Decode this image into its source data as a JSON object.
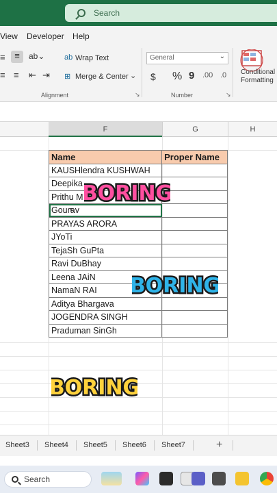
{
  "search": {
    "placeholder": "Search"
  },
  "menu": [
    "View",
    "Developer",
    "Help"
  ],
  "ribbon": {
    "wrap_text": "Wrap Text",
    "merge_center": "Merge & Center",
    "number_format": "General",
    "currency_symbol": "$",
    "percent_symbol": "%",
    "comma_symbol": "9",
    "conditional_line1": "Conditional",
    "conditional_line2": "Formatting",
    "alignment_label": "Alignment",
    "number_label": "Number"
  },
  "columns": {
    "f": "F",
    "g": "G",
    "h": "H"
  },
  "table": {
    "headers": [
      "Name",
      "Proper Name"
    ],
    "rows": [
      [
        "KAUSHlendra KUSHWAH",
        ""
      ],
      [
        "Deepika",
        ""
      ],
      [
        "Prithu M",
        ""
      ],
      [
        "Gourav",
        ""
      ],
      [
        "PRAYAS ARORA",
        ""
      ],
      [
        "JYoTi",
        ""
      ],
      [
        "TejaSh GuPta",
        ""
      ],
      [
        "Ravi DuBhay",
        ""
      ],
      [
        "Leena JAiN",
        ""
      ],
      [
        "NamaN RAI",
        ""
      ],
      [
        "Aditya Bhargava",
        ""
      ],
      [
        "JOGENDRA SINGH",
        ""
      ],
      [
        "Praduman SinGh",
        ""
      ]
    ]
  },
  "stickers": {
    "text": "BORING"
  },
  "sheet_tabs": [
    "Sheet3",
    "Sheet4",
    "Sheet5",
    "Sheet6",
    "Sheet7"
  ],
  "add_sheet": "+",
  "taskbar": {
    "search": "Search"
  }
}
